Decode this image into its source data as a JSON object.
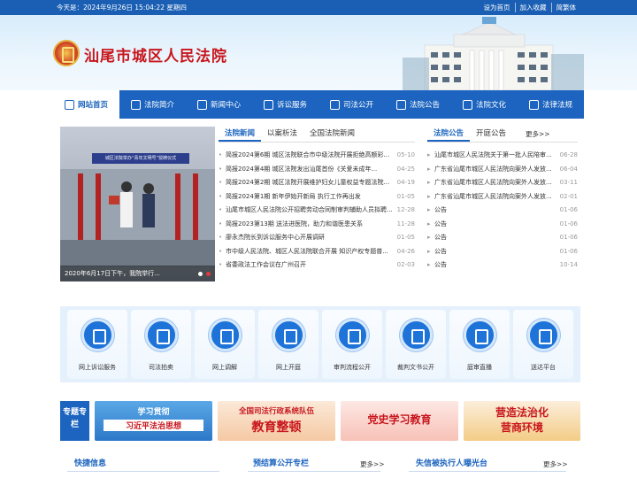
{
  "topbar": {
    "date": "今天是：2024年9月26日 15:04:22 星期四",
    "links": [
      "设为首页",
      "加入收藏",
      "简繁体"
    ]
  },
  "header": {
    "title": "汕尾市城区人民法院"
  },
  "nav": [
    {
      "label": "网站首页",
      "icon": "home-icon"
    },
    {
      "label": "法院简介",
      "icon": "org-icon"
    },
    {
      "label": "新闻中心",
      "icon": "news-icon"
    },
    {
      "label": "诉讼服务",
      "icon": "chat-icon"
    },
    {
      "label": "司法公开",
      "icon": "mail-icon"
    },
    {
      "label": "法院公告",
      "icon": "notice-icon"
    },
    {
      "label": "法院文化",
      "icon": "scale-icon"
    },
    {
      "label": "法律法规",
      "icon": "court-icon"
    }
  ],
  "slider": {
    "banner": "城区法院举办“青年文明号”授牌仪式",
    "caption": "2020年6月17日下午，我院举行..."
  },
  "news": {
    "tabs": [
      "法院新闻",
      "以案析法",
      "全国法院新闻"
    ],
    "items": [
      {
        "title": "简报2024第6期 城区法院联合市中级法院开展拒绝高额彩...",
        "date": "05-10"
      },
      {
        "title": "简报2024第4期 城区法院发出汕尾首份《关爱未成年...",
        "date": "04-25"
      },
      {
        "title": "简报2024第2期 城区法院开展维护妇女儿童权益专题法院...",
        "date": "04-19"
      },
      {
        "title": "简报2024第1期 新年伊始开新局 执行工作再出发",
        "date": "01-05"
      },
      {
        "title": "汕尾市城区人民法院公开招聘劳动合同制审判辅助人员拟聘...",
        "date": "12-28"
      },
      {
        "title": "简报2023第13期 送法进医院，助力和谐医患关系",
        "date": "11-28"
      },
      {
        "title": "廖永杰院长到诉讼服务中心开展调研",
        "date": "01-05"
      },
      {
        "title": "市中级人民法院、城区人民法院联合开展 知识产权专题普...",
        "date": "04-26"
      },
      {
        "title": "省委政法工作会议在广州召开",
        "date": "02-03"
      }
    ]
  },
  "notice": {
    "tabs": [
      "法院公告",
      "开庭公告"
    ],
    "more": "更多>>",
    "items": [
      {
        "title": "汕尾市城区人民法院关于第一批人民陪审...",
        "date": "06-28"
      },
      {
        "title": "广东省汕尾市城区人民法院向案外人发放...",
        "date": "06-04"
      },
      {
        "title": "广东省汕尾市城区人民法院向案外人发放...",
        "date": "03-11"
      },
      {
        "title": "广东省汕尾市城区人民法院向案外人发放...",
        "date": "02-01"
      },
      {
        "title": "公告",
        "date": "01-06"
      },
      {
        "title": "公告",
        "date": "01-06"
      },
      {
        "title": "公告",
        "date": "01-06"
      },
      {
        "title": "公告",
        "date": "01-06"
      },
      {
        "title": "公告",
        "date": "10-14"
      }
    ]
  },
  "services": [
    "网上诉讼服务",
    "司法拍卖",
    "网上调解",
    "网上开庭",
    "审判流程公开",
    "裁判文书公开",
    "庭审直播",
    "送达平台"
  ],
  "special": {
    "tag": "专题专栏",
    "banners": [
      {
        "line1": "学习贯彻",
        "line2": "习近平法治思想"
      },
      {
        "line1": "全国司法行政系统队伍",
        "line2": "教育整顿"
      },
      {
        "line1": "党史学习教育",
        "line2": ""
      },
      {
        "line1": "营造法治化",
        "line2": "营商环境"
      }
    ]
  },
  "bottom": {
    "quick": "快捷信息",
    "budget": "预结算公开专栏",
    "budget_more": "更多>>",
    "dishonest": "失信被执行人曝光台",
    "dishonest_more": "更多>>"
  }
}
